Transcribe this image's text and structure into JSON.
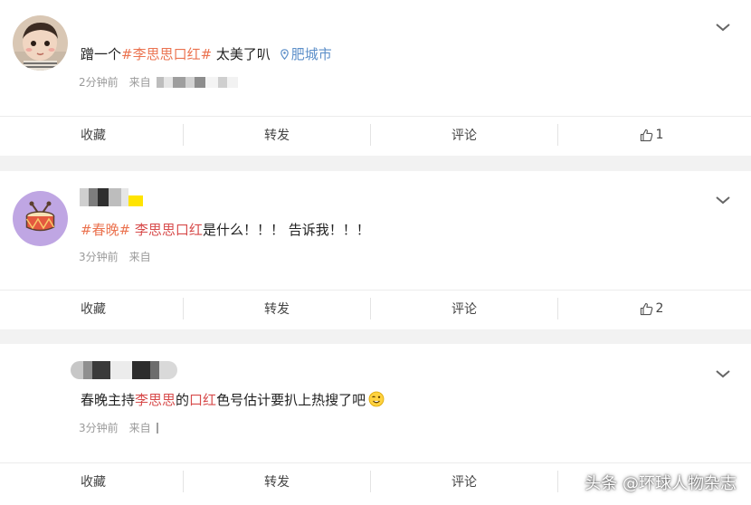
{
  "posts": [
    {
      "text_parts": [
        "蹭一个",
        "#李思思口红#",
        " 太美了叭"
      ],
      "location": "肥城市",
      "time": "2分钟前",
      "source_prefix": "来自",
      "actions": {
        "favorite": "收藏",
        "repost": "转发",
        "comment": "评论",
        "like_count": "1"
      }
    },
    {
      "text_parts": [
        "#春晚#",
        " ",
        "李思思口红",
        "是什么！！！ 告诉我！！！"
      ],
      "time": "3分钟前",
      "source_prefix": "来自",
      "actions": {
        "favorite": "收藏",
        "repost": "转发",
        "comment": "评论",
        "like_count": "2"
      }
    },
    {
      "text_parts": [
        "春晚主持",
        "李思思",
        "的",
        "口红",
        "色号估计要扒上热搜了吧"
      ],
      "time": "3分钟前",
      "source_prefix": "来自",
      "actions": {
        "favorite": "收藏",
        "repost": "转发",
        "comment": "评论"
      }
    }
  ],
  "watermark": "头条 @环球人物杂志",
  "colors": {
    "topic": "#eb7350",
    "highlight": "#d74b4b",
    "location": "#5d8fc9",
    "meta_text": "#9a9a9a"
  }
}
